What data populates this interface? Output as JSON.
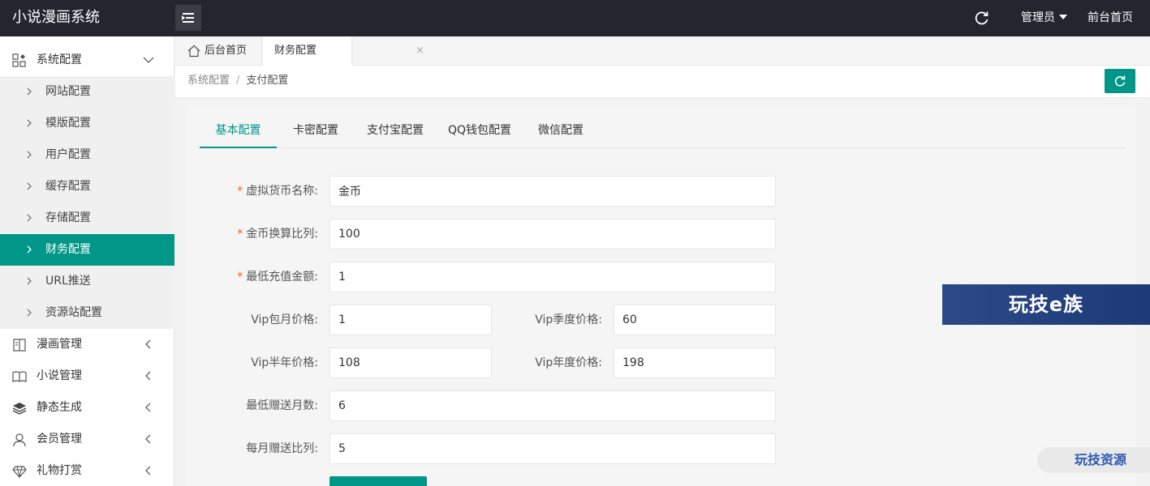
{
  "header": {
    "app_title": "小说漫画系统",
    "admin_label": "管理员",
    "front_link": "前台首页"
  },
  "sidebar": {
    "system_config": {
      "label": "系统配置",
      "icon": "grid-icon",
      "expanded": true
    },
    "sub_items": [
      {
        "label": "网站配置",
        "active": false
      },
      {
        "label": "模版配置",
        "active": false
      },
      {
        "label": "用户配置",
        "active": false
      },
      {
        "label": "缓存配置",
        "active": false
      },
      {
        "label": "存储配置",
        "active": false
      },
      {
        "label": "财务配置",
        "active": true
      },
      {
        "label": "URL推送",
        "active": false
      },
      {
        "label": "资源站配置",
        "active": false
      }
    ],
    "groups": [
      {
        "label": "漫画管理",
        "icon": "book-icon"
      },
      {
        "label": "小说管理",
        "icon": "open-book-icon"
      },
      {
        "label": "静态生成",
        "icon": "layers-icon"
      },
      {
        "label": "会员管理",
        "icon": "user-icon"
      },
      {
        "label": "礼物打赏",
        "icon": "diamond-icon"
      }
    ]
  },
  "tabs": [
    {
      "label": "后台首页",
      "icon": "home-icon"
    },
    {
      "label": "财务配置",
      "close": "×"
    }
  ],
  "breadcrumb": {
    "parent": "系统配置",
    "separator": "/",
    "current": "支付配置"
  },
  "subtabs": [
    {
      "label": "基本配置",
      "active": true
    },
    {
      "label": "卡密配置",
      "active": false
    },
    {
      "label": "支付宝配置",
      "active": false
    },
    {
      "label": "QQ钱包配置",
      "active": false
    },
    {
      "label": "微信配置",
      "active": false
    }
  ],
  "form": {
    "required_mark": "*",
    "currency_name": {
      "label": "虚拟货币名称:",
      "value": "金币",
      "required": true
    },
    "exchange_ratio": {
      "label": "金币换算比列:",
      "value": "100",
      "required": true
    },
    "min_recharge": {
      "label": "最低充值金额:",
      "value": "1",
      "required": true
    },
    "vip_month": {
      "label": "Vip包月价格:",
      "value": "1"
    },
    "vip_quarter": {
      "label": "Vip季度价格:",
      "value": "60"
    },
    "vip_half_year": {
      "label": "Vip半年价格:",
      "value": "108"
    },
    "vip_year": {
      "label": "Vip年度价格:",
      "value": "198"
    },
    "min_gift_months": {
      "label": "最低赠送月数:",
      "value": "6"
    },
    "monthly_gift_ratio": {
      "label": "每月赠送比列:",
      "value": "5"
    }
  },
  "watermarks": {
    "banner": "玩技e族",
    "corner": "玩技资源"
  },
  "colors": {
    "accent": "#009688",
    "header_bg": "#23262e",
    "required": "#ff5722"
  }
}
